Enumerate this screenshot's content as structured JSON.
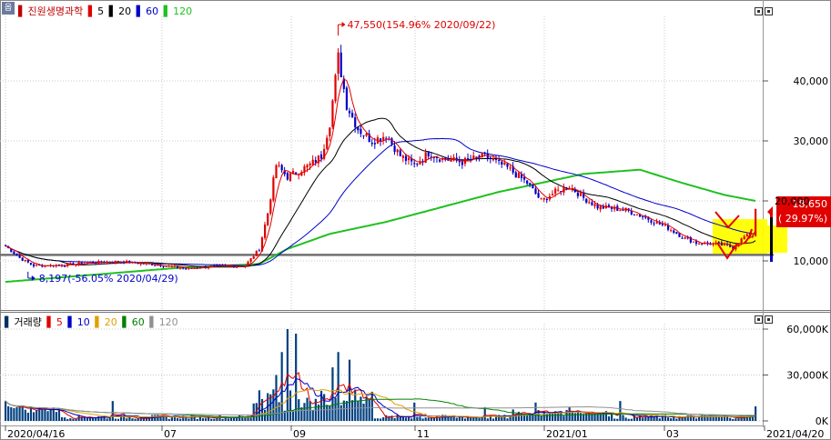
{
  "corner_icon": "chart-settings-icon",
  "corner_label": "옵",
  "price_legend": {
    "stock_name": "진원생명과학",
    "ma": [
      {
        "label": "5",
        "color": "#e00000"
      },
      {
        "label": "20",
        "color": "#000000"
      },
      {
        "label": "60",
        "color": "#0000c8"
      },
      {
        "label": "120",
        "color": "#20c020"
      }
    ]
  },
  "volume_legend": {
    "title": "거래량",
    "ma": [
      {
        "label": "5",
        "color": "#e00000"
      },
      {
        "label": "10",
        "color": "#0000c8"
      },
      {
        "label": "20",
        "color": "#e0a000"
      },
      {
        "label": "60",
        "color": "#008000"
      },
      {
        "label": "120",
        "color": "#909090"
      }
    ]
  },
  "annotations": {
    "high": "47,550(154.96% 2020/09/22)",
    "low": "8,197(-56.05% 2020/04/29)",
    "current_price": "18,650",
    "current_change": "( 29.97%)"
  },
  "price_axis_labels": [
    "40,000",
    "30,000",
    "20,000",
    "10,000"
  ],
  "volume_axis_labels": [
    "60,000K",
    "30,000K",
    "0K"
  ],
  "date_labels": [
    "2020/04/16",
    "07",
    "09",
    "11",
    "2021/01",
    "03",
    "2021/04/20"
  ],
  "colors": {
    "up": "#e00000",
    "down": "#0000c8",
    "ma5": "#e00000",
    "ma20": "#000000",
    "ma60": "#0000c8",
    "ma120": "#20c020",
    "support": "#808080",
    "highlight": "#ffff00",
    "volume": "#004080"
  },
  "chart_data": {
    "type": "candlestick",
    "title": "진원생명과학",
    "date_range": [
      "2020/04/16",
      "2021/04/20"
    ],
    "price_axis": {
      "ticks": [
        10000,
        20000,
        30000,
        40000
      ],
      "range": [
        4000,
        49000
      ]
    },
    "volume_axis": {
      "ticks": [
        0,
        30000,
        60000
      ],
      "unit": "K",
      "range": [
        0,
        66000
      ]
    },
    "high": {
      "value": 47550,
      "date": "2020/09/22",
      "pct": 154.96
    },
    "low": {
      "value": 8197,
      "date": "2020/04/29",
      "pct": -56.05
    },
    "last": {
      "value": 18650,
      "pct": 29.97
    },
    "support_level": 11000,
    "close_keyframes": [
      [
        0,
        12500
      ],
      [
        5,
        10500
      ],
      [
        10,
        9200
      ],
      [
        20,
        9300
      ],
      [
        30,
        9700
      ],
      [
        40,
        9900
      ],
      [
        55,
        9300
      ],
      [
        65,
        8700
      ],
      [
        70,
        9000
      ],
      [
        78,
        9100
      ],
      [
        85,
        9200
      ],
      [
        90,
        12000
      ],
      [
        93,
        18000
      ],
      [
        96,
        26000
      ],
      [
        100,
        24000
      ],
      [
        108,
        26000
      ],
      [
        112,
        27500
      ],
      [
        115,
        33000
      ],
      [
        118,
        44000
      ],
      [
        121,
        36000
      ],
      [
        125,
        32000
      ],
      [
        130,
        30000
      ],
      [
        135,
        31000
      ],
      [
        140,
        27500
      ],
      [
        145,
        26000
      ],
      [
        150,
        28000
      ],
      [
        155,
        27000
      ],
      [
        162,
        26500
      ],
      [
        170,
        27500
      ],
      [
        178,
        25500
      ],
      [
        185,
        23000
      ],
      [
        190,
        20000
      ],
      [
        195,
        21500
      ],
      [
        200,
        22500
      ],
      [
        205,
        20500
      ],
      [
        210,
        19000
      ],
      [
        220,
        18500
      ],
      [
        228,
        17000
      ],
      [
        235,
        15500
      ],
      [
        240,
        14000
      ],
      [
        245,
        13000
      ],
      [
        252,
        12800
      ],
      [
        258,
        12300
      ],
      [
        262,
        14000
      ],
      [
        265,
        14350
      ],
      [
        266,
        18650
      ]
    ],
    "ma120_keyframes": [
      [
        0,
        6500
      ],
      [
        60,
        8800
      ],
      [
        90,
        9500
      ],
      [
        100,
        12000
      ],
      [
        115,
        14500
      ],
      [
        135,
        16500
      ],
      [
        155,
        19000
      ],
      [
        175,
        21500
      ],
      [
        190,
        23000
      ],
      [
        205,
        24500
      ],
      [
        225,
        25200
      ],
      [
        240,
        23000
      ],
      [
        255,
        21000
      ],
      [
        266,
        20000
      ]
    ],
    "volume_spikes_k": [
      [
        0,
        13000
      ],
      [
        12,
        9000
      ],
      [
        38,
        13000
      ],
      [
        90,
        20000
      ],
      [
        96,
        30000
      ],
      [
        98,
        45000
      ],
      [
        100,
        60000
      ],
      [
        103,
        57000
      ],
      [
        116,
        35000
      ],
      [
        118,
        45000
      ],
      [
        122,
        40000
      ],
      [
        145,
        12000
      ],
      [
        170,
        9000
      ],
      [
        188,
        12000
      ],
      [
        200,
        9000
      ],
      [
        218,
        13000
      ],
      [
        266,
        9500
      ]
    ]
  }
}
